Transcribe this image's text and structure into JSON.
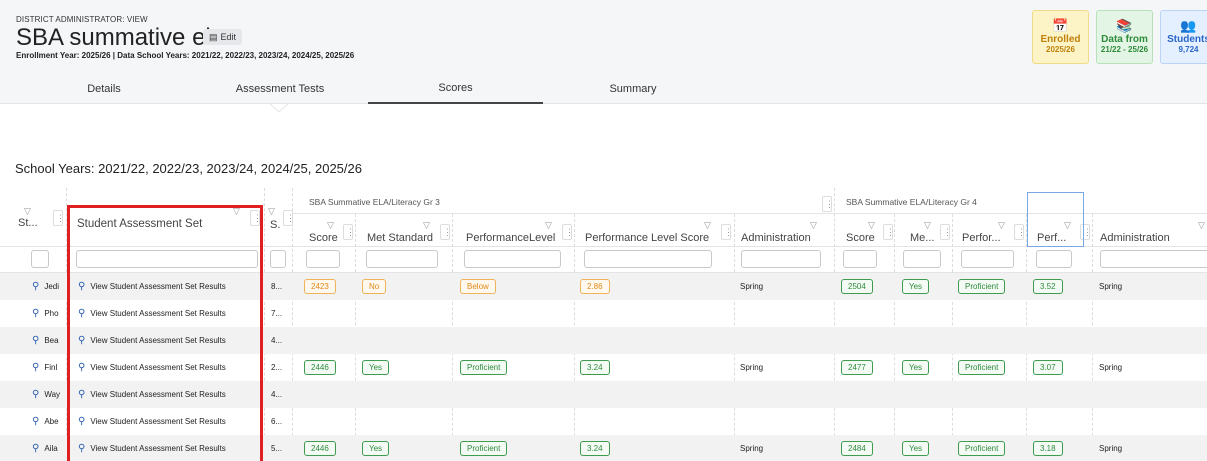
{
  "header": {
    "role": "DISTRICT ADMINISTRATOR: VIEW",
    "title": "SBA summative ela",
    "edit_label": "Edit",
    "subtitle": "Enrollment Year: 2025/26 | Data School Years: 2021/22, 2022/23, 2023/24, 2024/25, 2025/26",
    "badges": [
      {
        "icon": "calendar-icon",
        "line1": "Enrolled",
        "line2": "2025/26",
        "color": "#c0820a"
      },
      {
        "icon": "books-icon",
        "line1": "Data from",
        "line2": "21/22 - 25/26",
        "color": "#2e8b3a"
      },
      {
        "icon": "students-icon",
        "line1": "Students",
        "line2": "9,724",
        "color": "#2a66c9"
      }
    ]
  },
  "tabs": [
    {
      "label": "Details"
    },
    {
      "label": "Assessment Tests"
    },
    {
      "label": "Scores",
      "active": true
    },
    {
      "label": "Summary"
    }
  ],
  "school_years": "School Years: 2021/22, 2022/23, 2023/24, 2024/25, 2025/26",
  "grid": {
    "groups": [
      "SBA Summative ELA/Literacy Gr 3",
      "SBA Summative ELA/Literacy Gr 4"
    ],
    "columns": {
      "student": "St...",
      "set": "Student Assessment Set",
      "s": "S.",
      "g3_score": "Score",
      "g3_met": "Met Standard",
      "g3_level": "PerformanceLevel",
      "g3_level_score": "Performance Level Score",
      "g3_admin": "Administration",
      "g4_score": "Score",
      "g4_met": "Me...",
      "g4_level": "Perfor...",
      "g4_level_score": "Perf...",
      "g4_admin": "Administration"
    },
    "link_text": "View Student Assessment Set Results",
    "rows": [
      {
        "student": "Jedi",
        "s": "8...",
        "g3": {
          "score": "2423",
          "met": "No",
          "level": "Below",
          "level_score": "2.86",
          "admin": "Spring",
          "tone": "orange"
        },
        "g4": {
          "score": "2504",
          "met": "Yes",
          "level": "Proficient",
          "level_score": "3.52",
          "admin": "Spring"
        }
      },
      {
        "student": "Pho",
        "s": "7..."
      },
      {
        "student": "Bea",
        "s": "4..."
      },
      {
        "student": "Finl",
        "s": "2...",
        "g3": {
          "score": "2446",
          "met": "Yes",
          "level": "Proficient",
          "level_score": "3.24",
          "admin": "Spring",
          "tone": "green"
        },
        "g4": {
          "score": "2477",
          "met": "Yes",
          "level": "Proficient",
          "level_score": "3.07",
          "admin": "Spring"
        }
      },
      {
        "student": "Way",
        "s": "4..."
      },
      {
        "student": "Abe",
        "s": "6..."
      },
      {
        "student": "Aila",
        "s": "5...",
        "g3": {
          "score": "2446",
          "met": "Yes",
          "level": "Proficient",
          "level_score": "3.24",
          "admin": "Spring",
          "tone": "green"
        },
        "g4": {
          "score": "2484",
          "met": "Yes",
          "level": "Proficient",
          "level_score": "3.18",
          "admin": "Spring"
        }
      }
    ]
  }
}
